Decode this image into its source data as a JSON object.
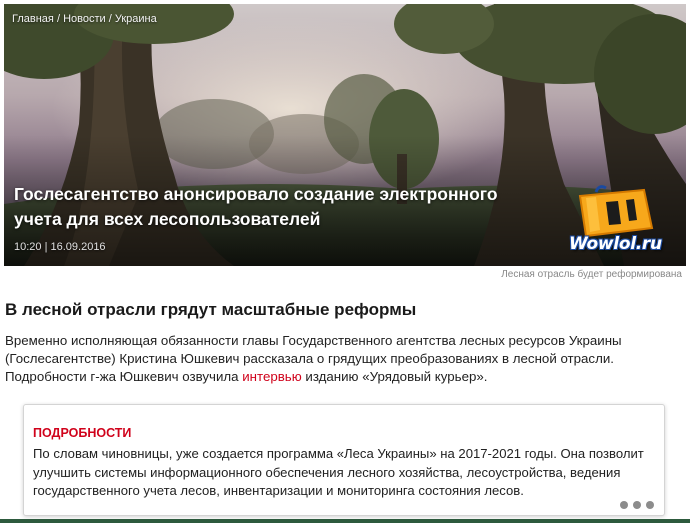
{
  "breadcrumb": {
    "home": "Главная",
    "news": "Новости",
    "region": "Украина",
    "separator": "/"
  },
  "hero": {
    "title": "Гослесагентство анонсировало создание электронного учета для всех лесопользователей",
    "date": "10:20 | 16.09.2016",
    "caption": "Лесная отрасль будет реформирована",
    "watermark": "Wowlol.ru"
  },
  "article": {
    "headline": "В лесной отрасли грядут масштабные реформы",
    "lead_before": "Временно исполняющая обязанности главы Государственного агентства лесных ресурсов Украины (Гослесагентстве) Кристина Юшкевич рассказала о грядущих преобразованиях в лесной отрасли. Подробности г-жа Юшкевич озвучила ",
    "lead_link": "интервью",
    "lead_after": " изданию «Урядовый курьер»."
  },
  "details": {
    "title": "ПОДРОБНОСТИ",
    "text": "По словам чиновницы, уже создается программа «Леса Украины» на 2017-2021 годы. Она позволит улучшить системы информационного обеспечения лесного хозяйства, лесоустройства, ведения государственного учета лесов, инвентаризации и мониторинга состояния лесов."
  },
  "colors": {
    "accent": "#d0021b",
    "footer": "#2d5a3d"
  }
}
